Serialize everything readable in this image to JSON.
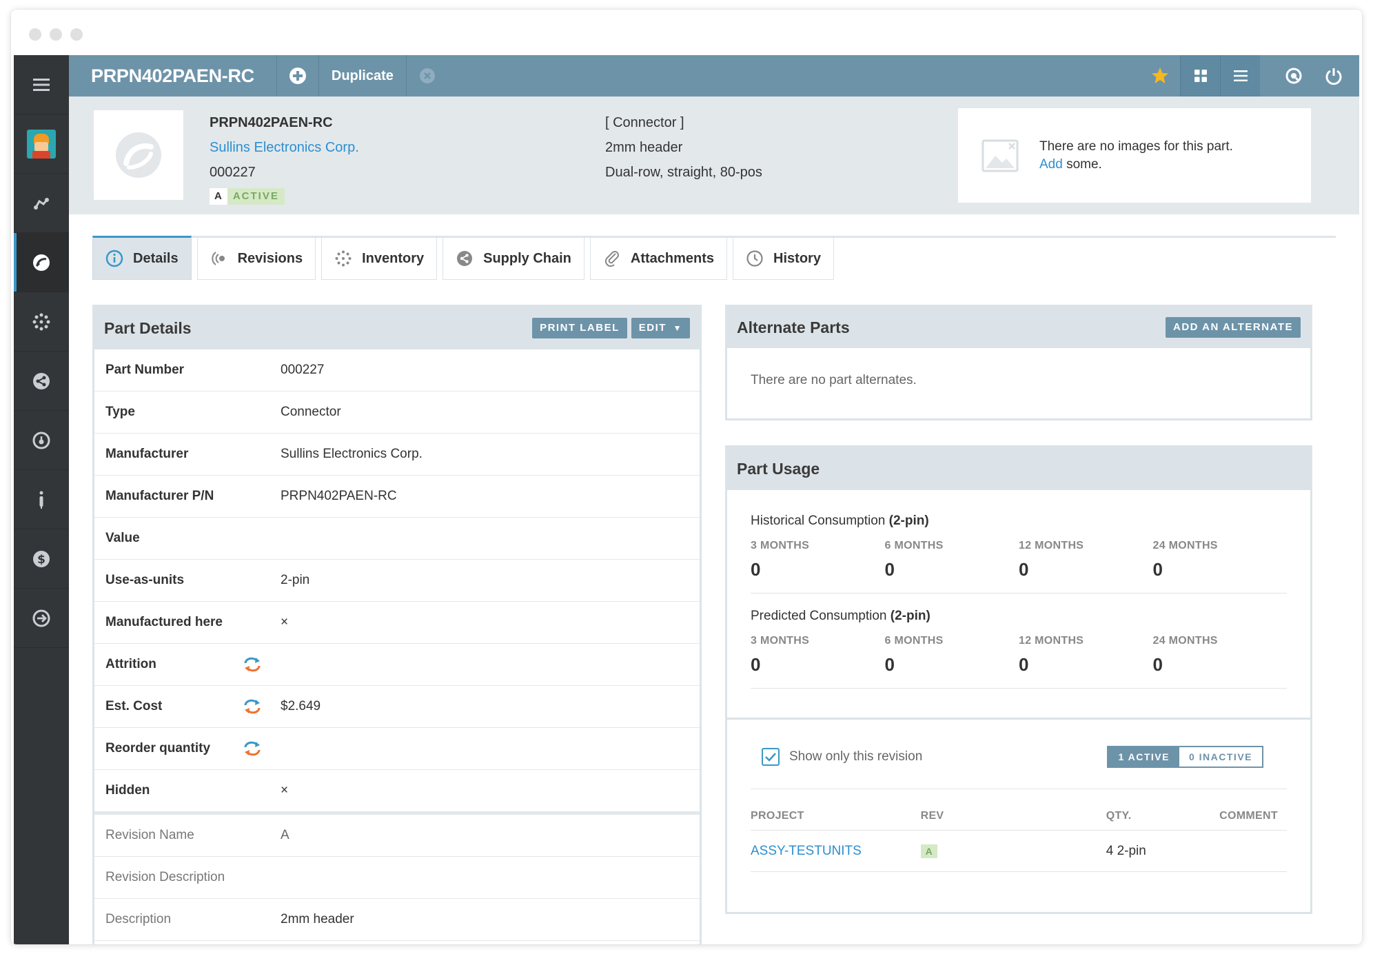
{
  "topbar": {
    "part_number": "PRPN402PAEN-RC",
    "duplicate_label": "Duplicate"
  },
  "summary": {
    "mpn": "PRPN402PAEN-RC",
    "manufacturer": "Sullins Electronics Corp.",
    "part_number": "000227",
    "revision": "A",
    "status": "ACTIVE",
    "type": "[ Connector ]",
    "description_short": "2mm header",
    "description_long": "Dual-row, straight, 80-pos",
    "no_images_text": "There are no images for this part.",
    "add_link": "Add",
    "add_suffix": " some."
  },
  "tabs": [
    {
      "label": "Details",
      "icon": "info-icon"
    },
    {
      "label": "Revisions",
      "icon": "revisions-icon"
    },
    {
      "label": "Inventory",
      "icon": "inventory-icon"
    },
    {
      "label": "Supply Chain",
      "icon": "supply-chain-icon"
    },
    {
      "label": "Attachments",
      "icon": "paperclip-icon"
    },
    {
      "label": "History",
      "icon": "clock-icon"
    }
  ],
  "part_details": {
    "title": "Part Details",
    "print_label": "PRINT LABEL",
    "edit_label": "EDIT",
    "rows": [
      {
        "key": "Part Number",
        "value": "000227"
      },
      {
        "key": "Type",
        "value": "Connector"
      },
      {
        "key": "Manufacturer",
        "value": "Sullins Electronics Corp."
      },
      {
        "key": "Manufacturer P/N",
        "value": "PRPN402PAEN-RC"
      },
      {
        "key": "Value",
        "value": ""
      },
      {
        "key": "Use-as-units",
        "value": "2-pin"
      },
      {
        "key": "Manufactured here",
        "value": "×"
      },
      {
        "key": "Attrition",
        "value": ""
      },
      {
        "key": "Est. Cost",
        "value": "$2.649"
      },
      {
        "key": "Reorder quantity",
        "value": ""
      },
      {
        "key": "Hidden",
        "value": "×"
      }
    ],
    "revision_rows": [
      {
        "key": "Revision Name",
        "value": "A"
      },
      {
        "key": "Revision Description",
        "value": ""
      },
      {
        "key": "Description",
        "value": "2mm header"
      }
    ]
  },
  "alternates": {
    "title": "Alternate Parts",
    "add_label": "ADD AN ALTERNATE",
    "empty_text": "There are no part alternates."
  },
  "usage": {
    "title": "Part Usage",
    "historical_label": "Historical Consumption",
    "predicted_label": "Predicted Consumption",
    "unit_label": "(2-pin)",
    "periods": [
      "3 MONTHS",
      "6 MONTHS",
      "12 MONTHS",
      "24 MONTHS"
    ],
    "historical_values": [
      "0",
      "0",
      "0",
      "0"
    ],
    "predicted_values": [
      "0",
      "0",
      "0",
      "0"
    ],
    "show_only_revision": "Show only this revision",
    "active_toggle": "1 ACTIVE",
    "inactive_toggle": "0 INACTIVE",
    "columns": [
      "PROJECT",
      "REV",
      "QTY.",
      "COMMENT"
    ],
    "rows": [
      {
        "project": "ASSY-TESTUNITS",
        "rev": "A",
        "qty": "4 2-pin",
        "comment": ""
      }
    ]
  }
}
